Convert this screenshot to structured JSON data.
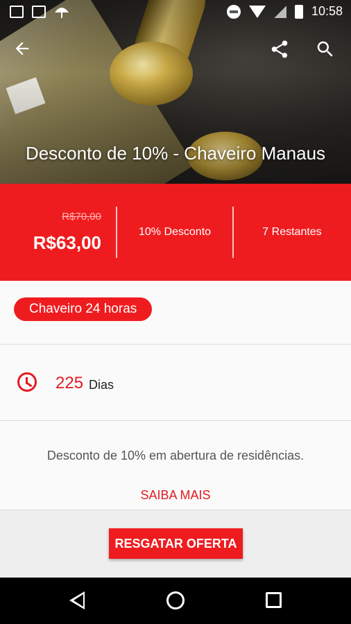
{
  "status_bar": {
    "time": "10:58",
    "left_icons": [
      "image-icon",
      "gmail-icon",
      "umbrella-icon"
    ],
    "right_icons": [
      "do-not-disturb-icon",
      "wifi-icon",
      "signal-icon",
      "battery-icon"
    ]
  },
  "toolbar": {
    "back_icon": "arrow-left-icon",
    "share_icon": "share-icon",
    "search_icon": "search-icon"
  },
  "hero": {
    "title": "Desconto de 10% - Chaveiro Manaus"
  },
  "price": {
    "old": "R$70,00",
    "new": "R$63,00",
    "discount": "10% Desconto",
    "remaining": "7 Restantes"
  },
  "category": {
    "label": "Chaveiro 24 horas"
  },
  "validity": {
    "icon": "clock-icon",
    "number": "225",
    "unit": "Dias"
  },
  "description": {
    "text": "Desconto de 10% em abertura de residências.",
    "more_label": "SAIBA MAIS"
  },
  "footer": {
    "cta_label": "RESGATAR OFERTA"
  },
  "colors": {
    "accent": "#ef1c1f",
    "accent_text": "#e21b22"
  },
  "navbar": {
    "icons": [
      "nav-back-icon",
      "nav-home-icon",
      "nav-recents-icon"
    ]
  }
}
